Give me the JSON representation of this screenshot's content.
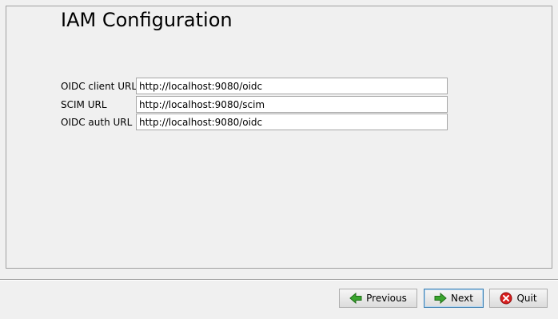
{
  "header": {
    "title": "IAM Configuration"
  },
  "form": {
    "fields": [
      {
        "label": "OIDC client URL",
        "value": "http://localhost:9080/oidc"
      },
      {
        "label": "SCIM URL",
        "value": "http://localhost:9080/scim"
      },
      {
        "label": "OIDC auth URL",
        "value": "http://localhost:9080/oidc"
      }
    ]
  },
  "footer": {
    "buttons": {
      "previous": {
        "label": "Previous",
        "icon": "arrow-left-icon"
      },
      "next": {
        "label": "Next",
        "icon": "arrow-right-icon"
      },
      "quit": {
        "label": "Quit",
        "icon": "close-circle-icon"
      }
    }
  },
  "colors": {
    "arrow_green": "#3aa52e",
    "quit_red": "#d81e1e",
    "focus_border": "#3c7fb1"
  }
}
